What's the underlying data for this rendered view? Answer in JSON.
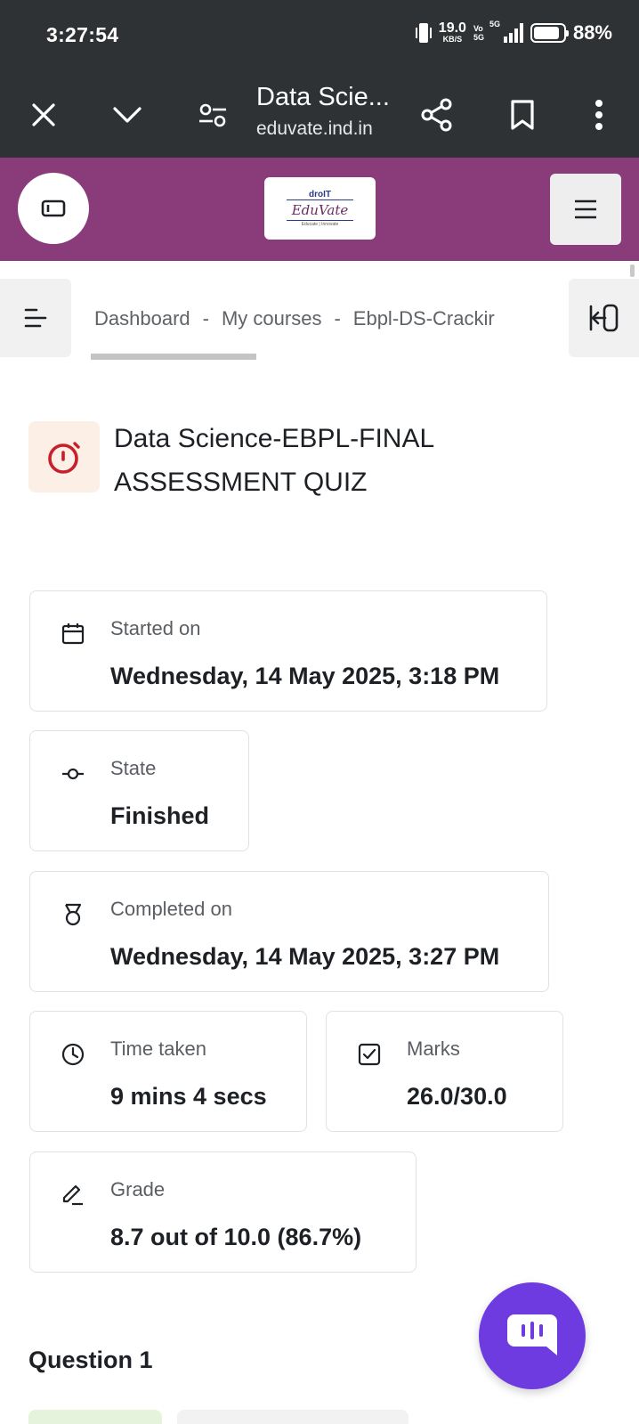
{
  "status_bar": {
    "time": "3:27:54",
    "speed_value": "19.0",
    "speed_unit": "KB/S",
    "volte_top": "Vo",
    "volte_bottom": "5G",
    "network": "5G",
    "battery_percent": "88%",
    "battery_level": 0.88
  },
  "browser": {
    "page_title": "Data Scie...",
    "url": "eduvate.ind.in",
    "icons": [
      "close-icon",
      "chevron-down-icon",
      "site-settings-icon",
      "share-icon",
      "bookmark-icon",
      "more-vert-icon"
    ]
  },
  "header": {
    "brand_top": "droIT",
    "brand_name": "EduVate",
    "brand_tagline": "Educate | Innovate",
    "colors": {
      "header_bg": "#8a3b7a",
      "accent": "#6d3be0"
    }
  },
  "breadcrumb": {
    "items": [
      "Dashboard",
      "My courses",
      "Ebpl-DS-Crackir"
    ],
    "separator": "-"
  },
  "activity": {
    "title": "Data Science-EBPL-FINAL ASSESSMENT QUIZ",
    "icon": "quiz-timer-icon"
  },
  "summary": {
    "started": {
      "label": "Started on",
      "value": "Wednesday, 14 May 2025, 3:18 PM"
    },
    "state": {
      "label": "State",
      "value": "Finished"
    },
    "completed": {
      "label": "Completed on",
      "value": "Wednesday, 14 May 2025, 3:27 PM"
    },
    "time_taken": {
      "label": "Time taken",
      "value": "9 mins 4 secs"
    },
    "marks": {
      "label": "Marks",
      "value": "26.0/30.0"
    },
    "grade": {
      "label": "Grade",
      "value": "8.7 out of 10.0 (86.7%)"
    }
  },
  "question": {
    "heading": "Question 1"
  }
}
